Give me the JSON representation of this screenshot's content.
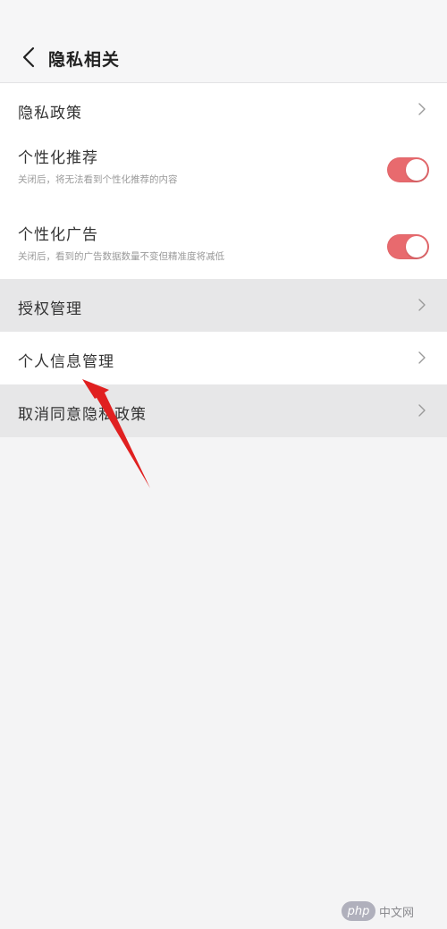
{
  "header": {
    "title": "隐私相关"
  },
  "items": [
    {
      "label": "隐私政策"
    },
    {
      "label": "个性化推荐",
      "description": "关闭后，将无法看到个性化推荐的内容",
      "toggle_on": true
    },
    {
      "label": "个性化广告",
      "description": "关闭后，看到的广告数据数量不变但精准度将减低",
      "toggle_on": true
    },
    {
      "label": "授权管理"
    },
    {
      "label": "个人信息管理"
    },
    {
      "label": "取消同意隐私政策"
    }
  ],
  "colors": {
    "toggle_on": "#e86a6e",
    "shaded_row": "#e7e7e8",
    "annotation_arrow": "#e02020"
  },
  "watermark": {
    "badge": "php",
    "text": "中文网"
  }
}
